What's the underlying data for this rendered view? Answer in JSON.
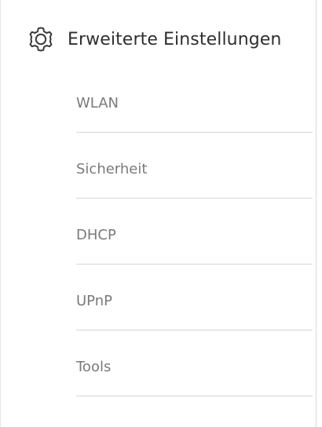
{
  "header": {
    "icon": "gear-icon",
    "title": "Erweiterte Einstellungen"
  },
  "menu": {
    "items": [
      {
        "label": "WLAN"
      },
      {
        "label": "Sicherheit"
      },
      {
        "label": "DHCP"
      },
      {
        "label": "UPnP"
      },
      {
        "label": "Tools"
      }
    ]
  },
  "colors": {
    "title_text": "#2f2f2f",
    "item_text": "#7a7a7a",
    "divider": "#d6d6d6",
    "panel_border": "#d9d9d9"
  }
}
